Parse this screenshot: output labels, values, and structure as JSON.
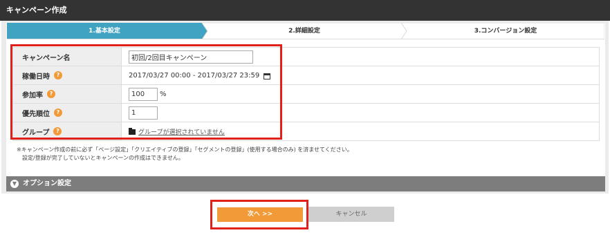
{
  "header": {
    "title": "キャンペーン作成"
  },
  "steps": [
    {
      "label": "1.基本設定",
      "active": true
    },
    {
      "label": "2.詳細設定",
      "active": false
    },
    {
      "label": "3.コンバージョン設定",
      "active": false
    }
  ],
  "colors": {
    "active_step": "#41a3c2",
    "accent": "#f29a38",
    "highlight": "#e0201b",
    "header_bg": "#333333",
    "option_bar": "#7d7d7d"
  },
  "form": {
    "campaign_name": {
      "label": "キャンペーン名",
      "value": "初回/2回目キャンペーン"
    },
    "period": {
      "label": "稼働日時",
      "value": "2017/03/27 00:00 - 2017/03/27 23:59"
    },
    "participation": {
      "label": "参加率",
      "value": "100",
      "unit": "%"
    },
    "priority": {
      "label": "優先順位",
      "value": "1"
    },
    "group": {
      "label": "グループ",
      "value": "グループが選択されていません"
    }
  },
  "help_icon": "?",
  "notes": {
    "line1": "※キャンペーン作成の前に必ず「ページ設定」「クリエイティブの登録」「セグメントの登録」(使用する場合のみ) を済ませてください。",
    "line2": "設定/登録が完了していないとキャンペーンの作成はできません。"
  },
  "option_section": {
    "label": "オプション設定"
  },
  "buttons": {
    "next": "次へ >>",
    "cancel": "キャンセル"
  }
}
